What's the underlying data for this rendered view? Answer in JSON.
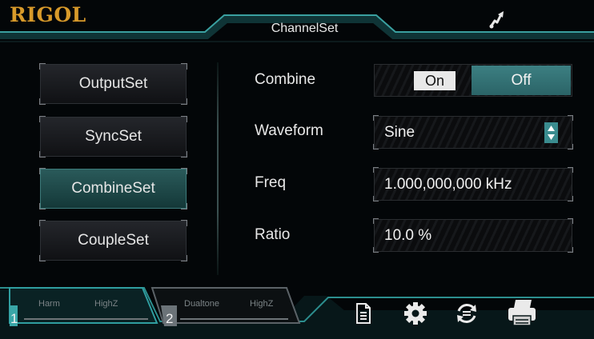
{
  "header": {
    "logo": "RIGOL",
    "title": "ChannelSet",
    "usb_icon": "usb-icon"
  },
  "menu": {
    "items": [
      {
        "label": "OutputSet",
        "active": false
      },
      {
        "label": "SyncSet",
        "active": false
      },
      {
        "label": "CombineSet",
        "active": true
      },
      {
        "label": "CoupleSet",
        "active": false
      }
    ]
  },
  "params": {
    "combine": {
      "label": "Combine",
      "on_label": "On",
      "off_label": "Off",
      "selected": "Off"
    },
    "waveform": {
      "label": "Waveform",
      "value": "Sine"
    },
    "freq": {
      "label": "Freq",
      "value": "1.000,000,000 kHz"
    },
    "ratio": {
      "label": "Ratio",
      "value": "10.0 %"
    }
  },
  "channels": [
    {
      "number": "1",
      "mode": "Harm",
      "load": "HighZ",
      "active": true
    },
    {
      "number": "2",
      "mode": "Dualtone",
      "load": "HighZ",
      "active": false
    }
  ],
  "toolbar": {
    "icons": [
      "document-icon",
      "gear-icon",
      "sync-icon",
      "printer-icon"
    ]
  },
  "colors": {
    "accent": "#3c7f82",
    "logo": "#d89a2a",
    "background": "#030608"
  }
}
